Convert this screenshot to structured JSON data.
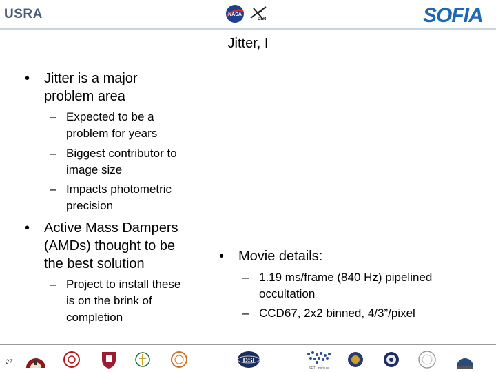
{
  "header": {
    "usra_logo_text": "USRA",
    "dlr_logo_text": "DLR",
    "sofia_logo_text": "SOFIA"
  },
  "slide": {
    "title": "Jitter, I",
    "left_column": {
      "bullet1": {
        "marker": "•",
        "lines": [
          "Jitter is a major",
          "problem area"
        ],
        "subs": [
          {
            "marker": "–",
            "lines": [
              "Expected to be a",
              "problem for years"
            ]
          },
          {
            "marker": "–",
            "lines": [
              "Biggest contributor to",
              "image size"
            ]
          },
          {
            "marker": "–",
            "lines": [
              "Impacts photometric",
              "precision"
            ]
          }
        ]
      },
      "bullet2": {
        "marker": "•",
        "lines": [
          "Active Mass Dampers",
          "(AMDs) thought to be",
          "the best solution"
        ],
        "subs": [
          {
            "marker": "–",
            "lines": [
              "Project to install these",
              "is on the brink of",
              "completion"
            ]
          }
        ]
      }
    },
    "right_column": {
      "bullet": {
        "marker": "•",
        "lines": [
          "Movie details:"
        ],
        "subs": [
          {
            "marker": "–",
            "lines": [
              "1.19 ms/frame (840 Hz) pipelined",
              "occultation"
            ]
          },
          {
            "marker": "–",
            "lines": [
              "CCD67, 2x2 binned, 4/3”/pixel"
            ]
          }
        ]
      }
    }
  },
  "footer": {
    "page_number": "27",
    "dsi_logo_text": "DSI",
    "seti_logo_text": "SETI Institute"
  },
  "colors": {
    "sofia_blue": "#1d67b5",
    "usra_gray": "#4a5d72"
  }
}
